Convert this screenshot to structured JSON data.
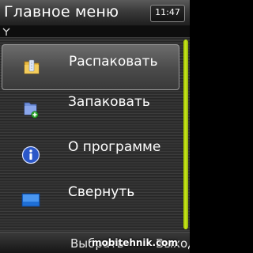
{
  "titlebar": {
    "title": "Главное меню",
    "time": "11:47"
  },
  "status": {
    "signal_icon": "antenna-icon"
  },
  "menu": {
    "items": [
      {
        "label": "Распаковать",
        "icon": "folder-archive-icon",
        "selected": true
      },
      {
        "label": "Запаковать",
        "icon": "folder-add-icon",
        "selected": false
      },
      {
        "label": "О программе",
        "icon": "info-icon",
        "selected": false
      },
      {
        "label": "Свернуть",
        "icon": "minimize-window-icon",
        "selected": false
      }
    ]
  },
  "softkeys": {
    "left": "Выбрать",
    "right": "Выход"
  },
  "watermark": "mobitehnik.com",
  "colors": {
    "scroll_accent": "#b4d400",
    "selection_border": "#9a9a9a"
  }
}
